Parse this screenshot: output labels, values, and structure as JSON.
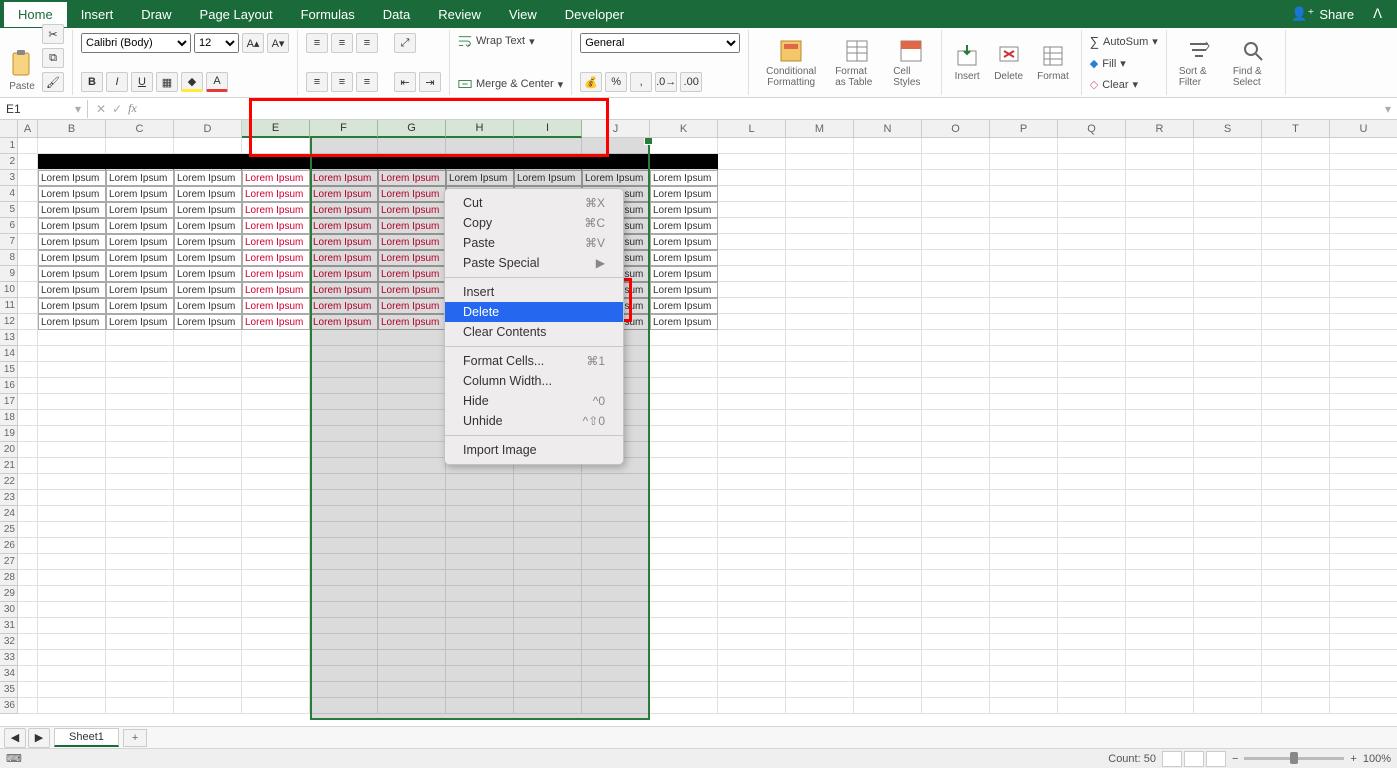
{
  "tabs": [
    "Home",
    "Insert",
    "Draw",
    "Page Layout",
    "Formulas",
    "Data",
    "Review",
    "View",
    "Developer"
  ],
  "active_tab": "Home",
  "share_label": "Share",
  "ribbon": {
    "paste_label": "Paste",
    "font_name": "Calibri (Body)",
    "font_size": "12",
    "wrap_label": "Wrap Text",
    "merge_label": "Merge & Center",
    "number_format": "General",
    "cond_fmt": "Conditional Formatting",
    "fmt_table": "Format as Table",
    "cell_styles": "Cell Styles",
    "insert": "Insert",
    "delete": "Delete",
    "format": "Format",
    "autosum": "AutoSum",
    "fill": "Fill",
    "clear": "Clear",
    "sort_filter": "Sort & Filter",
    "find_select": "Find & Select"
  },
  "name_box": "E1",
  "formula": "",
  "columns": [
    "A",
    "B",
    "C",
    "D",
    "E",
    "F",
    "G",
    "H",
    "I",
    "J",
    "K",
    "L",
    "M",
    "N",
    "O",
    "P",
    "Q",
    "R",
    "S",
    "T",
    "U"
  ],
  "selected_columns": [
    "E",
    "F",
    "G",
    "H",
    "I"
  ],
  "num_rows": 36,
  "data_rows_start": 3,
  "data_rows_end": 12,
  "cell_text": "Lorem Ipsum",
  "data_columns": [
    "B",
    "C",
    "D",
    "E",
    "F",
    "G",
    "H",
    "I",
    "J",
    "K"
  ],
  "red_columns": [
    "E",
    "F",
    "G"
  ],
  "black_row": 2,
  "ctx_menu": {
    "items": [
      {
        "label": "Cut",
        "short": "⌘X"
      },
      {
        "label": "Copy",
        "short": "⌘C"
      },
      {
        "label": "Paste",
        "short": "⌘V"
      },
      {
        "label": "Paste Special",
        "short": "▶"
      },
      {
        "type": "sep"
      },
      {
        "label": "Insert",
        "short": ""
      },
      {
        "label": "Delete",
        "short": "",
        "hover": true
      },
      {
        "label": "Clear Contents",
        "short": ""
      },
      {
        "type": "sep"
      },
      {
        "label": "Format Cells...",
        "short": "⌘1"
      },
      {
        "label": "Column Width...",
        "short": ""
      },
      {
        "label": "Hide",
        "short": "^0"
      },
      {
        "label": "Unhide",
        "short": "^⇧0"
      },
      {
        "type": "sep"
      },
      {
        "label": "Import Image",
        "short": ""
      }
    ]
  },
  "sheet_tabs": [
    "Sheet1"
  ],
  "status": {
    "count_label": "Count:",
    "count_value": "50",
    "zoom": "100%"
  }
}
